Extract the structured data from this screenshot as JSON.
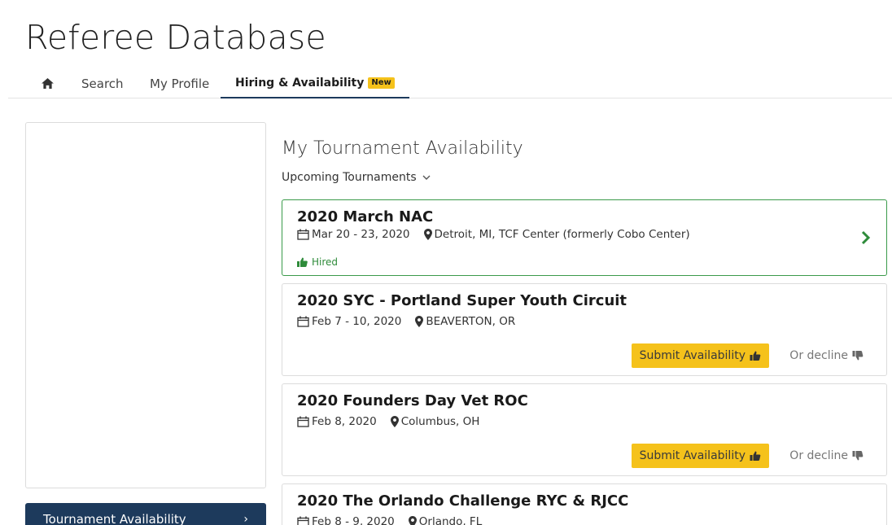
{
  "app": {
    "title": "Referee Database"
  },
  "nav": {
    "home_icon": "home-icon",
    "search": "Search",
    "profile": "My Profile",
    "hiring": "Hiring & Availability",
    "hiring_badge": "New"
  },
  "sidebar": {
    "active_tab": "Tournament Availability"
  },
  "main": {
    "title": "My Tournament Availability",
    "filter": "Upcoming Tournaments",
    "submit_label": "Submit Availability",
    "decline_label": "Or decline",
    "tournaments": [
      {
        "name": "2020 March NAC",
        "dates": "Mar 20 - 23, 2020",
        "location": "Detroit, MI, TCF Center (formerly Cobo Center)",
        "status": "Hired"
      },
      {
        "name": "2020 SYC - Portland Super Youth Circuit",
        "dates": "Feb 7 - 10, 2020",
        "location": "BEAVERTON, OR"
      },
      {
        "name": "2020 Founders Day Vet ROC",
        "dates": "Feb 8, 2020",
        "location": "Columbus, OH"
      },
      {
        "name": "2020 The Orlando Challenge RYC & RJCC",
        "dates": "Feb 8 - 9, 2020",
        "location": "Orlando, FL"
      }
    ]
  },
  "colors": {
    "accent_yellow": "#f5c21b",
    "navy": "#1d3a5c",
    "hired_green": "#3a9a4a"
  }
}
